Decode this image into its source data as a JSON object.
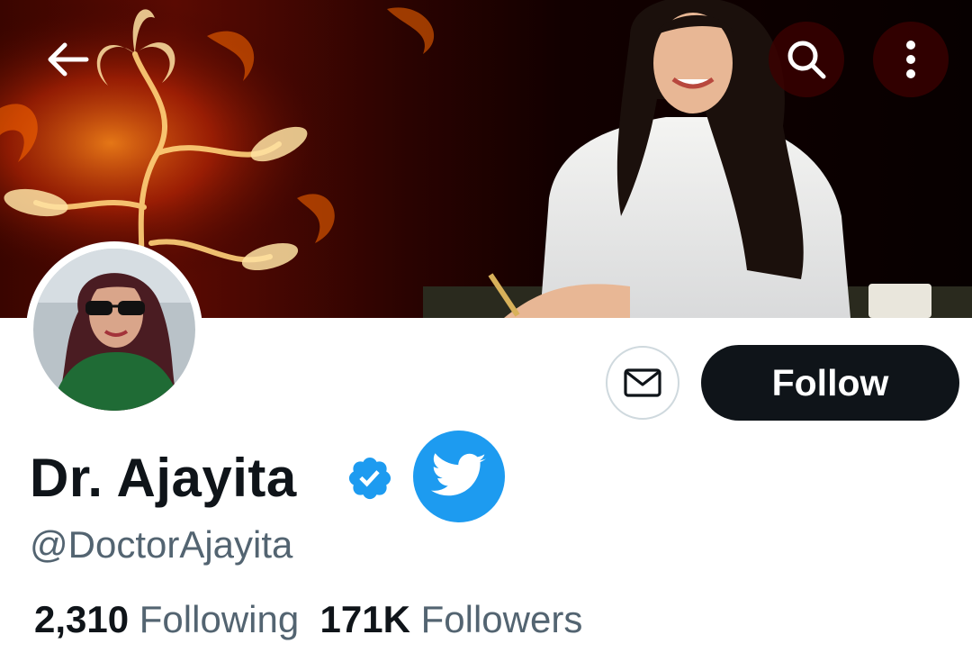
{
  "header": {
    "back_icon": "arrow-left-icon",
    "search_icon": "search-icon",
    "more_icon": "more-vertical-icon"
  },
  "profile": {
    "display_name": "Dr. Ajayita",
    "handle": "@DoctorAjayita",
    "verified_icon": "verified-badge-icon",
    "extra_badge_icon": "twitter-bird-icon",
    "follow_label": "Follow",
    "message_icon": "envelope-icon"
  },
  "stats": {
    "following_count": "2,310",
    "following_label": "Following",
    "followers_count": "171K",
    "followers_label": "Followers"
  },
  "colors": {
    "follow_bg": "#0f1419",
    "secondary_text": "#536471",
    "verified_blue": "#1d9bf0",
    "twitter_blue": "#1d9bf0"
  }
}
